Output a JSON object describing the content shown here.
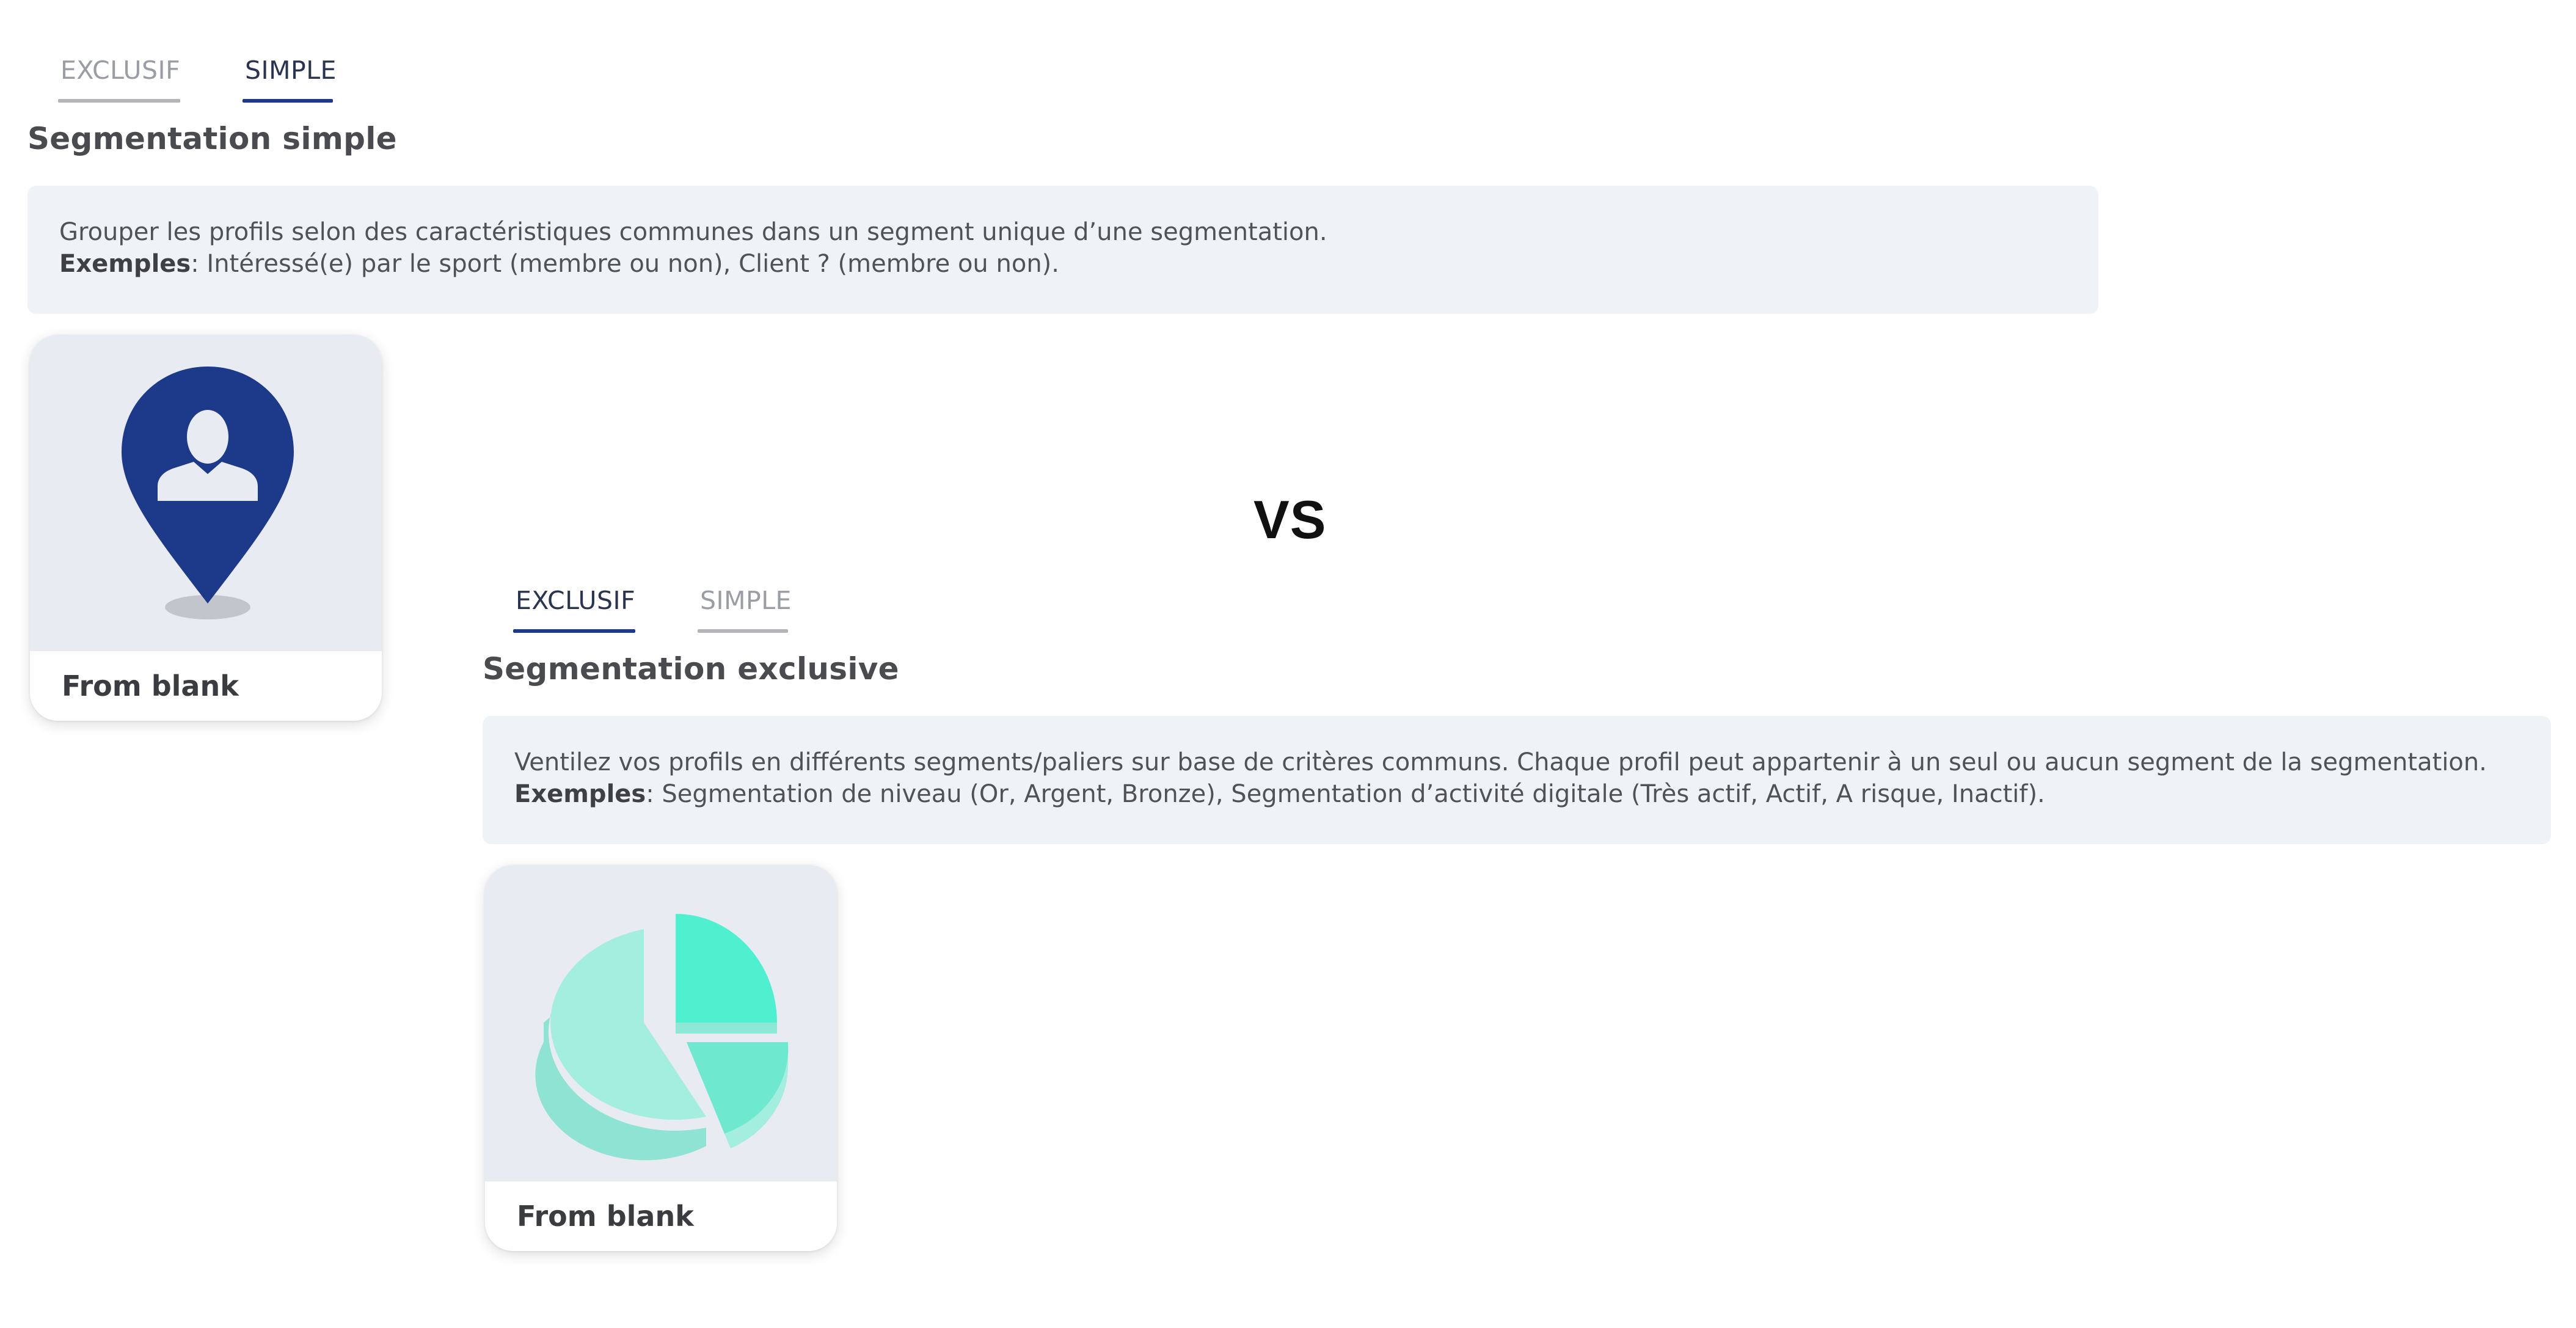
{
  "panel_simple": {
    "tabs": [
      {
        "label": "EXCLUSIF",
        "active": false
      },
      {
        "label": "SIMPLE",
        "active": true
      }
    ],
    "title": "Segmentation simple",
    "description": "Grouper les profils selon des caractéristiques communes dans un segment unique d’une segmentation.",
    "examples_label": "Exemples",
    "examples_text": ": Intéressé(e) par le sport (membre ou non), Client ? (membre ou non).",
    "card": {
      "icon": "location-pin-user-icon",
      "label": "From blank"
    }
  },
  "vs_label": "VS",
  "panel_exclusive": {
    "tabs": [
      {
        "label": "EXCLUSIF",
        "active": true
      },
      {
        "label": "SIMPLE",
        "active": false
      }
    ],
    "title": "Segmentation exclusive",
    "description": "Ventilez vos profils en différents segments/paliers sur base de critères communs. Chaque profil peut appartenir à un seul ou aucun segment de la segmentation.",
    "examples_label": "Exemples",
    "examples_text": ": Segmentation de niveau (Or, Argent, Bronze), Segmentation d’activité digitale (Très actif, Actif, A risque, Inactif).",
    "card": {
      "icon": "pie-chart-icon",
      "label": "From blank"
    }
  },
  "colors": {
    "accent": "#1d3a8a",
    "tab_inactive": "#9a9da3",
    "info_box_bg": "#eff2f7",
    "card_image_bg": "#e9ebf3",
    "pin_blue": "#1d3a8a",
    "pie_teal": "#4ef0cf",
    "pie_teal_light": "#a3eedf"
  }
}
